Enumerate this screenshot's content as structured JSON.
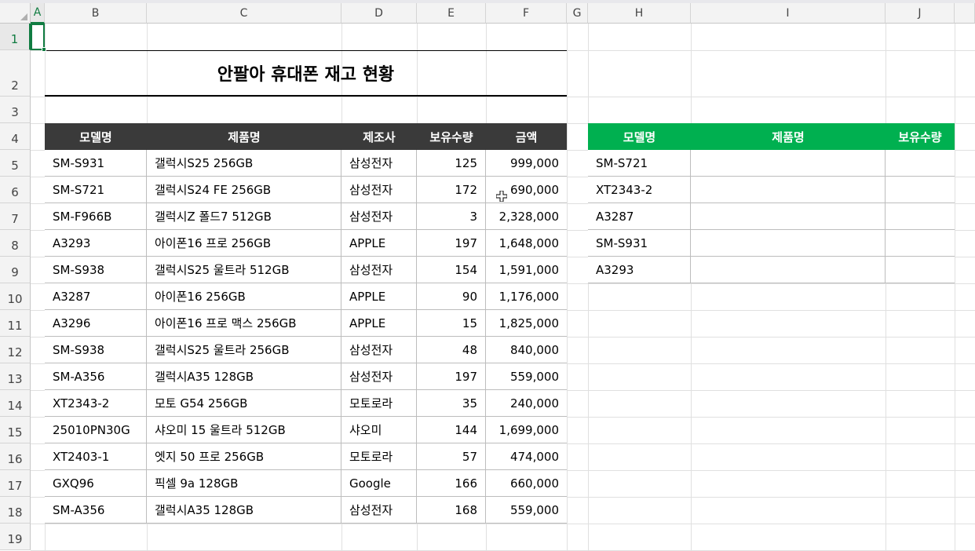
{
  "columns": [
    "A",
    "B",
    "C",
    "D",
    "E",
    "F",
    "G",
    "H",
    "I",
    "J"
  ],
  "rows": [
    "1",
    "2",
    "3",
    "4",
    "5",
    "6",
    "7",
    "8",
    "9",
    "10",
    "11",
    "12",
    "13",
    "14",
    "15",
    "16",
    "17",
    "18",
    "19"
  ],
  "selected_cell": "A1",
  "title": "안팔아 휴대폰 재고 현황",
  "main_table": {
    "headers": [
      "모델명",
      "제품명",
      "제조사",
      "보유수량",
      "금액"
    ],
    "rows": [
      [
        "SM-S931",
        "갤럭시S25 256GB",
        "삼성전자",
        "125",
        "999,000"
      ],
      [
        "SM-S721",
        "갤럭시S24 FE 256GB",
        "삼성전자",
        "172",
        "690,000"
      ],
      [
        "SM-F966B",
        "갤럭시Z 폴드7 512GB",
        "삼성전자",
        "3",
        "2,328,000"
      ],
      [
        "A3293",
        "아이폰16 프로 256GB",
        "APPLE",
        "197",
        "1,648,000"
      ],
      [
        "SM-S938",
        "갤럭시S25 울트라 512GB",
        "삼성전자",
        "154",
        "1,591,000"
      ],
      [
        "A3287",
        "아이폰16 256GB",
        "APPLE",
        "90",
        "1,176,000"
      ],
      [
        "A3296",
        "아이폰16 프로 맥스 256GB",
        "APPLE",
        "15",
        "1,825,000"
      ],
      [
        "SM-S938",
        "갤럭시S25 울트라 256GB",
        "삼성전자",
        "48",
        "840,000"
      ],
      [
        "SM-A356",
        "갤럭시A35 128GB",
        "삼성전자",
        "197",
        "559,000"
      ],
      [
        "XT2343-2",
        "모토 G54 256GB",
        "모토로라",
        "35",
        "240,000"
      ],
      [
        "25010PN30G",
        "샤오미 15 울트라 512GB",
        "샤오미",
        "144",
        "1,699,000"
      ],
      [
        "XT2403-1",
        "엣지 50 프로 256GB",
        "모토로라",
        "57",
        "474,000"
      ],
      [
        "GXQ96",
        "픽셀 9a 128GB",
        "Google",
        "166",
        "660,000"
      ],
      [
        "SM-A356",
        "갤럭시A35 128GB",
        "삼성전자",
        "168",
        "559,000"
      ]
    ]
  },
  "lookup_table": {
    "headers": [
      "모델명",
      "제품명",
      "보유수량"
    ],
    "rows": [
      [
        "SM-S721",
        "",
        ""
      ],
      [
        "XT2343-2",
        "",
        ""
      ],
      [
        "A3287",
        "",
        ""
      ],
      [
        "SM-S931",
        "",
        ""
      ],
      [
        "A3293",
        "",
        ""
      ]
    ]
  },
  "colors": {
    "dark_header": "#3a3a3a",
    "green_header": "#00b050",
    "selection": "#107c41"
  }
}
